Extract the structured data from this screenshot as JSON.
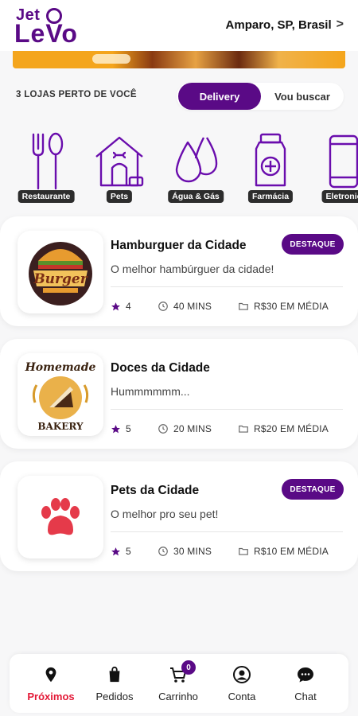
{
  "header": {
    "logo_top": "Jet",
    "logo_bottom": "LeVo",
    "location": "Amparo, SP, Brasil",
    "location_chevron": ">"
  },
  "stores_bar": {
    "count_label": "3 LOJAS PERTO DE VOCÊ",
    "delivery_label": "Delivery",
    "pickup_label": "Vou buscar",
    "selected": "Delivery"
  },
  "categories": [
    {
      "label": "Restaurante",
      "icon": "fork-spoon-icon"
    },
    {
      "label": "Pets",
      "icon": "doghouse-icon"
    },
    {
      "label": "Água & Gás",
      "icon": "water-drops-icon"
    },
    {
      "label": "Farmácia",
      "icon": "medicine-bottle-icon"
    },
    {
      "label": "Eletronic",
      "icon": "smartphone-icon"
    }
  ],
  "stores": [
    {
      "name": "Hamburguer da Cidade",
      "description": "O melhor hambúrguer da cidade!",
      "rating": "4",
      "time": "40 MINS",
      "price": "R$30 EM MÉDIA",
      "badge": "DESTAQUE",
      "logo": "burger-logo"
    },
    {
      "name": "Doces da Cidade",
      "description": "Hummmmmm...",
      "rating": "5",
      "time": "20 MINS",
      "price": "R$20 EM MÉDIA",
      "badge": "",
      "logo": "bakery-logo"
    },
    {
      "name": "Pets da Cidade",
      "description": "O melhor pro seu pet!",
      "rating": "5",
      "time": "30 MINS",
      "price": "R$10 EM MÉDIA",
      "badge": "DESTAQUE",
      "logo": "paw-logo"
    }
  ],
  "logo_texts": {
    "burger": "Burger",
    "bakery_top": "Homemade",
    "bakery_bottom": "BAKERY"
  },
  "nav": {
    "items": [
      {
        "label": "Próximos",
        "icon": "location-pin-icon",
        "active": true
      },
      {
        "label": "Pedidos",
        "icon": "shopping-bag-icon",
        "active": false
      },
      {
        "label": "Carrinho",
        "icon": "cart-icon",
        "active": false
      },
      {
        "label": "Conta",
        "icon": "account-icon",
        "active": false
      },
      {
        "label": "Chat",
        "icon": "chat-bubble-icon",
        "active": false
      }
    ],
    "cart_count": "0"
  },
  "colors": {
    "brand": "#5a0a86",
    "active_nav": "#e31836"
  }
}
